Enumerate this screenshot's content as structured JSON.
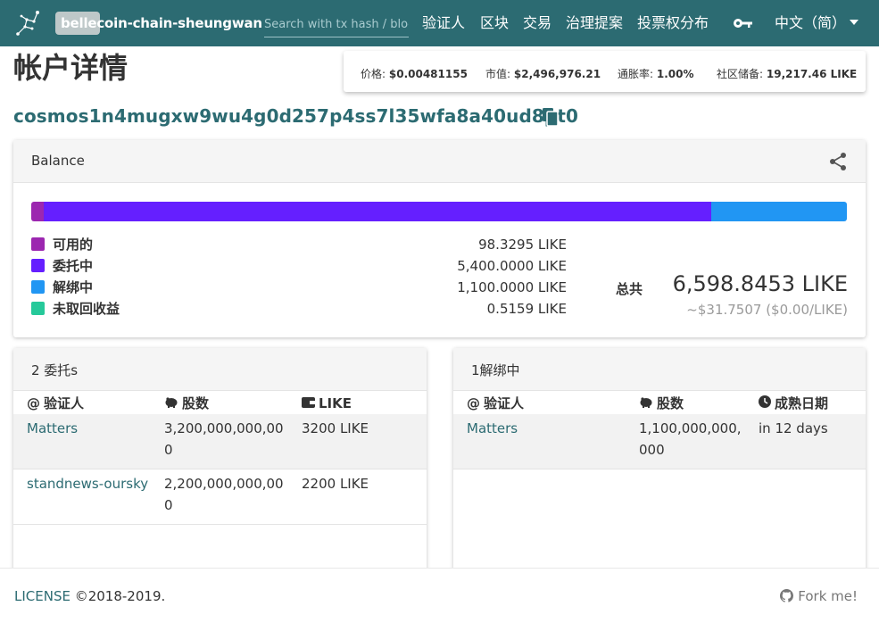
{
  "header": {
    "brand": "bellecoin-chain-sheungwan",
    "search_placeholder": "Search with tx hash / block",
    "nav": [
      "验证人",
      "区块",
      "交易",
      "治理提案",
      "投票权分布"
    ],
    "language": "中文（简）"
  },
  "page": {
    "title": "帐户详情",
    "address": "cosmos1n4mugxw9wu4g0d257p4ss7l35wfa8a40ud8pt0"
  },
  "stats": [
    {
      "label": "价格:",
      "value": "$0.00481155"
    },
    {
      "label": "市值:",
      "value": "$2,496,976.21"
    },
    {
      "label": "通胀率:",
      "value": "1.00%"
    },
    {
      "label": "社区储备:",
      "value": "19,217.46 LIKE"
    }
  ],
  "balance": {
    "title": "Balance",
    "items": [
      {
        "label": "可用的",
        "value": "98.3295 LIKE",
        "amount": 98.3295,
        "color": "#9c27b0"
      },
      {
        "label": "委托中",
        "value": "5,400.0000 LIKE",
        "amount": 5400.0,
        "color": "#651fff"
      },
      {
        "label": "解绑中",
        "value": "1,100.0000 LIKE",
        "amount": 1100.0,
        "color": "#2196f3"
      },
      {
        "label": "未取回收益",
        "value": "0.5159 LIKE",
        "amount": 0.5159,
        "color": "#26c99a"
      }
    ],
    "total_label": "总共",
    "total": "6,598.8453 LIKE",
    "total_fiat": "~$31.7507 ($0.00/LIKE)"
  },
  "delegations": {
    "title": "2 委托s",
    "headers": [
      "验证人",
      "股数",
      "LIKE"
    ],
    "rows": [
      {
        "validator": "Matters",
        "shares_1": "3,200,000,000,00",
        "shares_2": "0",
        "amount": "3200 LIKE"
      },
      {
        "validator": "standnews-oursky",
        "shares_1": "2,200,000,000,00",
        "shares_2": "0",
        "amount": "2200 LIKE"
      }
    ]
  },
  "unbonding": {
    "title": "1解绑中",
    "headers": [
      "验证人",
      "股数",
      "成熟日期"
    ],
    "rows": [
      {
        "validator": "Matters",
        "shares_1": "1,100,000,000,",
        "shares_2": "000",
        "mature": "in 12 days"
      }
    ]
  },
  "footer": {
    "license_link": "LICENSE",
    "copyright": " ©2018-2019.",
    "fork": "Fork me!"
  },
  "colors": {
    "primary": "#2c6b72",
    "link": "#2c6b72"
  }
}
